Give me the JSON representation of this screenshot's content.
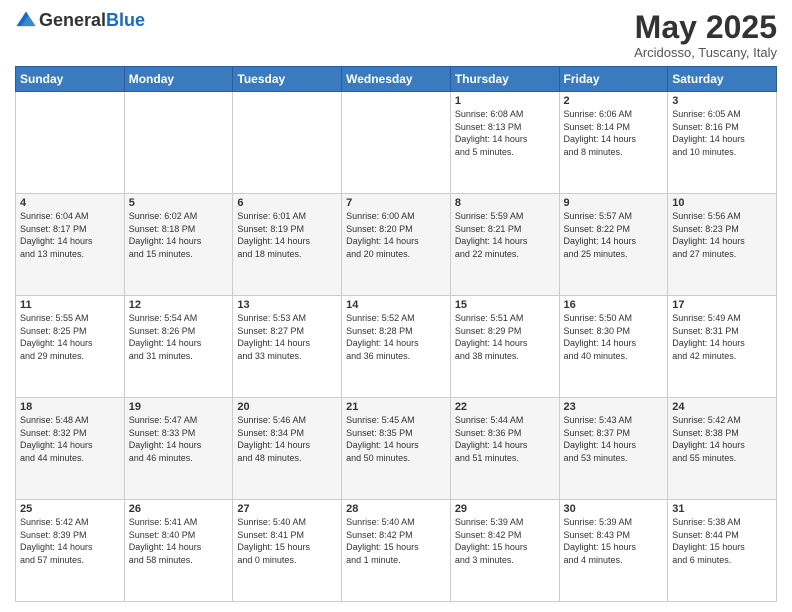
{
  "logo": {
    "general": "General",
    "blue": "Blue"
  },
  "header": {
    "month_title": "May 2025",
    "location": "Arcidosso, Tuscany, Italy"
  },
  "weekdays": [
    "Sunday",
    "Monday",
    "Tuesday",
    "Wednesday",
    "Thursday",
    "Friday",
    "Saturday"
  ],
  "weeks": [
    [
      {
        "day": "",
        "info": ""
      },
      {
        "day": "",
        "info": ""
      },
      {
        "day": "",
        "info": ""
      },
      {
        "day": "",
        "info": ""
      },
      {
        "day": "1",
        "info": "Sunrise: 6:08 AM\nSunset: 8:13 PM\nDaylight: 14 hours\nand 5 minutes."
      },
      {
        "day": "2",
        "info": "Sunrise: 6:06 AM\nSunset: 8:14 PM\nDaylight: 14 hours\nand 8 minutes."
      },
      {
        "day": "3",
        "info": "Sunrise: 6:05 AM\nSunset: 8:16 PM\nDaylight: 14 hours\nand 10 minutes."
      }
    ],
    [
      {
        "day": "4",
        "info": "Sunrise: 6:04 AM\nSunset: 8:17 PM\nDaylight: 14 hours\nand 13 minutes."
      },
      {
        "day": "5",
        "info": "Sunrise: 6:02 AM\nSunset: 8:18 PM\nDaylight: 14 hours\nand 15 minutes."
      },
      {
        "day": "6",
        "info": "Sunrise: 6:01 AM\nSunset: 8:19 PM\nDaylight: 14 hours\nand 18 minutes."
      },
      {
        "day": "7",
        "info": "Sunrise: 6:00 AM\nSunset: 8:20 PM\nDaylight: 14 hours\nand 20 minutes."
      },
      {
        "day": "8",
        "info": "Sunrise: 5:59 AM\nSunset: 8:21 PM\nDaylight: 14 hours\nand 22 minutes."
      },
      {
        "day": "9",
        "info": "Sunrise: 5:57 AM\nSunset: 8:22 PM\nDaylight: 14 hours\nand 25 minutes."
      },
      {
        "day": "10",
        "info": "Sunrise: 5:56 AM\nSunset: 8:23 PM\nDaylight: 14 hours\nand 27 minutes."
      }
    ],
    [
      {
        "day": "11",
        "info": "Sunrise: 5:55 AM\nSunset: 8:25 PM\nDaylight: 14 hours\nand 29 minutes."
      },
      {
        "day": "12",
        "info": "Sunrise: 5:54 AM\nSunset: 8:26 PM\nDaylight: 14 hours\nand 31 minutes."
      },
      {
        "day": "13",
        "info": "Sunrise: 5:53 AM\nSunset: 8:27 PM\nDaylight: 14 hours\nand 33 minutes."
      },
      {
        "day": "14",
        "info": "Sunrise: 5:52 AM\nSunset: 8:28 PM\nDaylight: 14 hours\nand 36 minutes."
      },
      {
        "day": "15",
        "info": "Sunrise: 5:51 AM\nSunset: 8:29 PM\nDaylight: 14 hours\nand 38 minutes."
      },
      {
        "day": "16",
        "info": "Sunrise: 5:50 AM\nSunset: 8:30 PM\nDaylight: 14 hours\nand 40 minutes."
      },
      {
        "day": "17",
        "info": "Sunrise: 5:49 AM\nSunset: 8:31 PM\nDaylight: 14 hours\nand 42 minutes."
      }
    ],
    [
      {
        "day": "18",
        "info": "Sunrise: 5:48 AM\nSunset: 8:32 PM\nDaylight: 14 hours\nand 44 minutes."
      },
      {
        "day": "19",
        "info": "Sunrise: 5:47 AM\nSunset: 8:33 PM\nDaylight: 14 hours\nand 46 minutes."
      },
      {
        "day": "20",
        "info": "Sunrise: 5:46 AM\nSunset: 8:34 PM\nDaylight: 14 hours\nand 48 minutes."
      },
      {
        "day": "21",
        "info": "Sunrise: 5:45 AM\nSunset: 8:35 PM\nDaylight: 14 hours\nand 50 minutes."
      },
      {
        "day": "22",
        "info": "Sunrise: 5:44 AM\nSunset: 8:36 PM\nDaylight: 14 hours\nand 51 minutes."
      },
      {
        "day": "23",
        "info": "Sunrise: 5:43 AM\nSunset: 8:37 PM\nDaylight: 14 hours\nand 53 minutes."
      },
      {
        "day": "24",
        "info": "Sunrise: 5:42 AM\nSunset: 8:38 PM\nDaylight: 14 hours\nand 55 minutes."
      }
    ],
    [
      {
        "day": "25",
        "info": "Sunrise: 5:42 AM\nSunset: 8:39 PM\nDaylight: 14 hours\nand 57 minutes."
      },
      {
        "day": "26",
        "info": "Sunrise: 5:41 AM\nSunset: 8:40 PM\nDaylight: 14 hours\nand 58 minutes."
      },
      {
        "day": "27",
        "info": "Sunrise: 5:40 AM\nSunset: 8:41 PM\nDaylight: 15 hours\nand 0 minutes."
      },
      {
        "day": "28",
        "info": "Sunrise: 5:40 AM\nSunset: 8:42 PM\nDaylight: 15 hours\nand 1 minute."
      },
      {
        "day": "29",
        "info": "Sunrise: 5:39 AM\nSunset: 8:42 PM\nDaylight: 15 hours\nand 3 minutes."
      },
      {
        "day": "30",
        "info": "Sunrise: 5:39 AM\nSunset: 8:43 PM\nDaylight: 15 hours\nand 4 minutes."
      },
      {
        "day": "31",
        "info": "Sunrise: 5:38 AM\nSunset: 8:44 PM\nDaylight: 15 hours\nand 6 minutes."
      }
    ]
  ]
}
